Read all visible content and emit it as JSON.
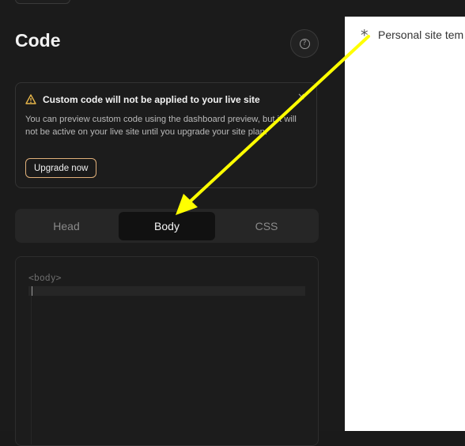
{
  "panel": {
    "title": "Code",
    "help_icon": "question-circle-icon"
  },
  "alert": {
    "icon": "warning-triangle-icon",
    "title": "Custom code will not be applied to your live site",
    "body": "You can preview custom code using the dashboard preview, but it will not be active on your live site until you upgrade your site plan.",
    "button": "Upgrade now",
    "close_icon": "close-icon",
    "accent_color": "#e0b07a"
  },
  "tabs": [
    {
      "label": "Head",
      "active": false
    },
    {
      "label": "Body",
      "active": true
    },
    {
      "label": "CSS",
      "active": false
    }
  ],
  "editor": {
    "line1": "<body>"
  },
  "preview": {
    "icon": "asterisk-icon",
    "text": "Personal site tem"
  },
  "annotation": {
    "type": "arrow",
    "color": "#ffff00"
  }
}
